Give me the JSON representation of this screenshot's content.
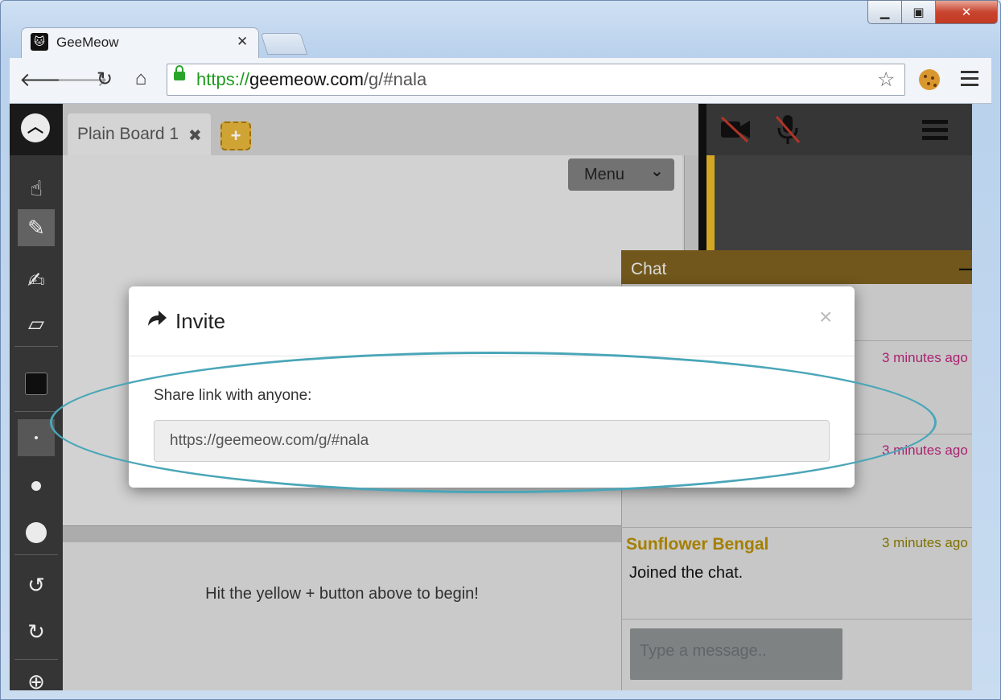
{
  "window": {
    "minimize_icon": "minimize-icon",
    "maximize_icon": "maximize-icon",
    "close_icon": "close-icon"
  },
  "browser": {
    "tab_title": "GeeMeow",
    "tab_close": "✕",
    "url_scheme": "https://",
    "url_host": "geemeow.com",
    "url_path": "/g/#nala"
  },
  "app": {
    "board_tab_label": "Plain Board 1",
    "board_tab_close": "✖",
    "add_board": "+",
    "menu_label": "Menu",
    "hint_text": "Hit the yellow + button above to begin!",
    "chat": {
      "title": "Chat",
      "messages": [
        {
          "time": "3 minutes ago"
        },
        {
          "time": "3 minutes ago"
        },
        {
          "name": "Sunflower Bengal",
          "time": "3 minutes ago",
          "text": "Joined the chat."
        }
      ],
      "input_placeholder": "Type a message.."
    }
  },
  "modal": {
    "title": "Invite",
    "close": "×",
    "share_label": "Share link with anyone:",
    "share_link": "https://geemeow.com/g/#nala"
  },
  "colors": {
    "accent_yellow": "#e2b13a",
    "highlight_oval": "#4aa6b8",
    "time_pink": "#b8267a"
  }
}
